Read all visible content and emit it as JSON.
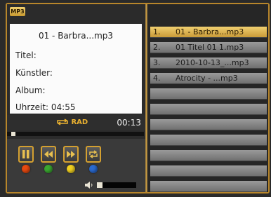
{
  "badge": "MP3",
  "track": {
    "filename": "01 - Barbra...mp3",
    "title_label": "Titel:",
    "artist_label": "Künstler:",
    "album_label": "Album:",
    "duration_label": "Uhrzeit: 04:55"
  },
  "playback": {
    "repeat_mode": "RAD",
    "elapsed": "00:13",
    "progress_fraction": 0.03,
    "volume_fraction": 0.15
  },
  "controls": [
    {
      "name": "pause",
      "icon": "pause-icon",
      "dot_color": "#e84a10"
    },
    {
      "name": "rewind",
      "icon": "rewind-icon",
      "dot_color": "#3aa830"
    },
    {
      "name": "fast-forward",
      "icon": "fast-forward-icon",
      "dot_color": "#f0d020"
    },
    {
      "name": "repeat",
      "icon": "repeat-icon",
      "dot_color": "#2a6ad0"
    }
  ],
  "playlist": [
    {
      "num": "1.",
      "title": "01 - Barbra...mp3",
      "active": true
    },
    {
      "num": "2.",
      "title": "01 Titel 01 1.mp3",
      "active": false
    },
    {
      "num": "3.",
      "title": "2010-10-13_...mp3",
      "active": false
    },
    {
      "num": "4.",
      "title": "Atrocity - ...mp3",
      "active": false
    },
    {
      "num": "",
      "title": "",
      "active": false
    },
    {
      "num": "",
      "title": "",
      "active": false
    },
    {
      "num": "",
      "title": "",
      "active": false
    },
    {
      "num": "",
      "title": "",
      "active": false
    },
    {
      "num": "",
      "title": "",
      "active": false
    },
    {
      "num": "",
      "title": "",
      "active": false
    },
    {
      "num": "",
      "title": "",
      "active": false
    }
  ],
  "colors": {
    "accent": "#d4a030",
    "active_row": "#e0b858",
    "info_bg": "#fbfbfb"
  }
}
